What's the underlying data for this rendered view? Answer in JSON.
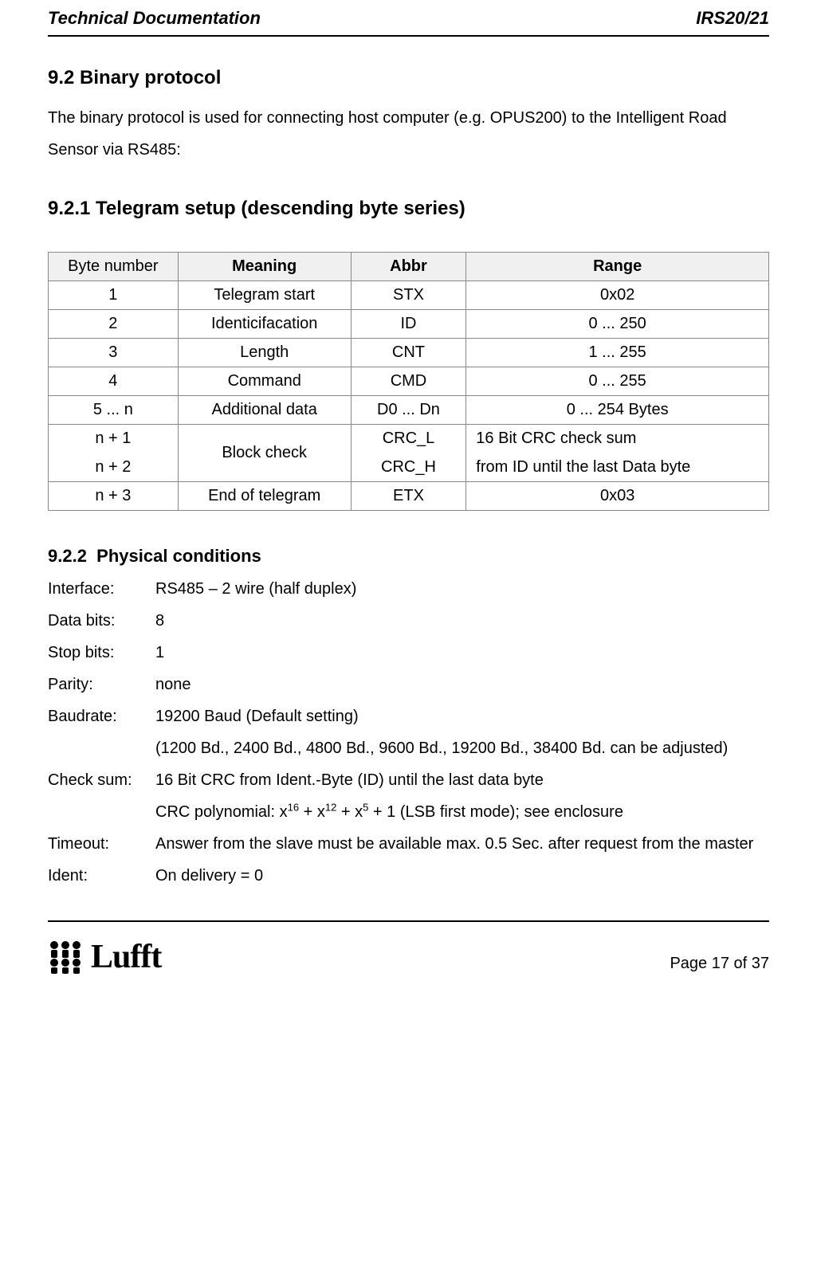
{
  "header": {
    "left": "Technical Documentation",
    "right": "IRS20/21"
  },
  "section_9_2": {
    "number_title": "9.2  Binary protocol",
    "intro_text": "The binary protocol is used for connecting host computer (e.g. OPUS200) to the Intelligent Road Sensor via RS485:"
  },
  "section_9_2_1": {
    "number_title": "9.2.1  Telegram setup (descending byte series)",
    "table": {
      "headers": [
        "Byte number",
        "Meaning",
        "Abbr",
        "Range"
      ],
      "rows": [
        {
          "byte": "1",
          "meaning": "Telegram start",
          "abbr": "STX",
          "range": "0x02"
        },
        {
          "byte": "2",
          "meaning": "Identicifacation",
          "abbr": "ID",
          "range": "0 ... 250"
        },
        {
          "byte": "3",
          "meaning": "Length",
          "abbr": "CNT",
          "range": "1 ... 255"
        },
        {
          "byte": "4",
          "meaning": "Command",
          "abbr": "CMD",
          "range": "0 ... 255"
        },
        {
          "byte": "5 ... n",
          "meaning": "Additional data",
          "abbr": "D0 ... Dn",
          "range": "0 ... 254 Bytes"
        }
      ],
      "crc": {
        "byte1": "n + 1",
        "byte2": "n + 2",
        "meaning": "Block check",
        "abbr1": "CRC_L",
        "abbr2": "CRC_H",
        "range1": "16 Bit CRC check sum",
        "range2": "from ID until the last Data byte"
      },
      "last": {
        "byte": "n + 3",
        "meaning": "End of telegram",
        "abbr": "ETX",
        "range": "0x03"
      }
    }
  },
  "section_9_2_2": {
    "number_title": "9.2.2",
    "subtitle": "Physical conditions",
    "defs": {
      "interface_label": "Interface:",
      "interface_value": "RS485 – 2 wire (half duplex)",
      "databits_label": "Data bits:",
      "databits_value": "8",
      "stopbits_label": "Stop bits:",
      "stopbits_value": "1",
      "parity_label": "Parity:",
      "parity_value": "none",
      "baudrate_label": "Baudrate:",
      "baudrate_value1": "19200 Baud (Default setting)",
      "baudrate_value2": "(1200 Bd., 2400 Bd., 4800 Bd., 9600 Bd., 19200 Bd., 38400 Bd. can be adjusted)",
      "checksum_label": "Check sum:",
      "checksum_value1": "16 Bit CRC from Ident.-Byte (ID) until the last data byte",
      "checksum_value2a": "CRC polynomial: x",
      "checksum_sup16": "16",
      "checksum_value2b": " + x",
      "checksum_sup12": "12",
      "checksum_value2c": " + x",
      "checksum_sup5": "5",
      "checksum_value2d": " + 1 (LSB first mode); see enclosure",
      "timeout_label": "Timeout:",
      "timeout_value": "Answer from the slave must be available max. 0.5 Sec. after request from the master",
      "ident_label": "Ident:",
      "ident_value": "On delivery = 0"
    }
  },
  "footer": {
    "logo_text": "Lufft",
    "page_label": "Page 17 of 37"
  }
}
